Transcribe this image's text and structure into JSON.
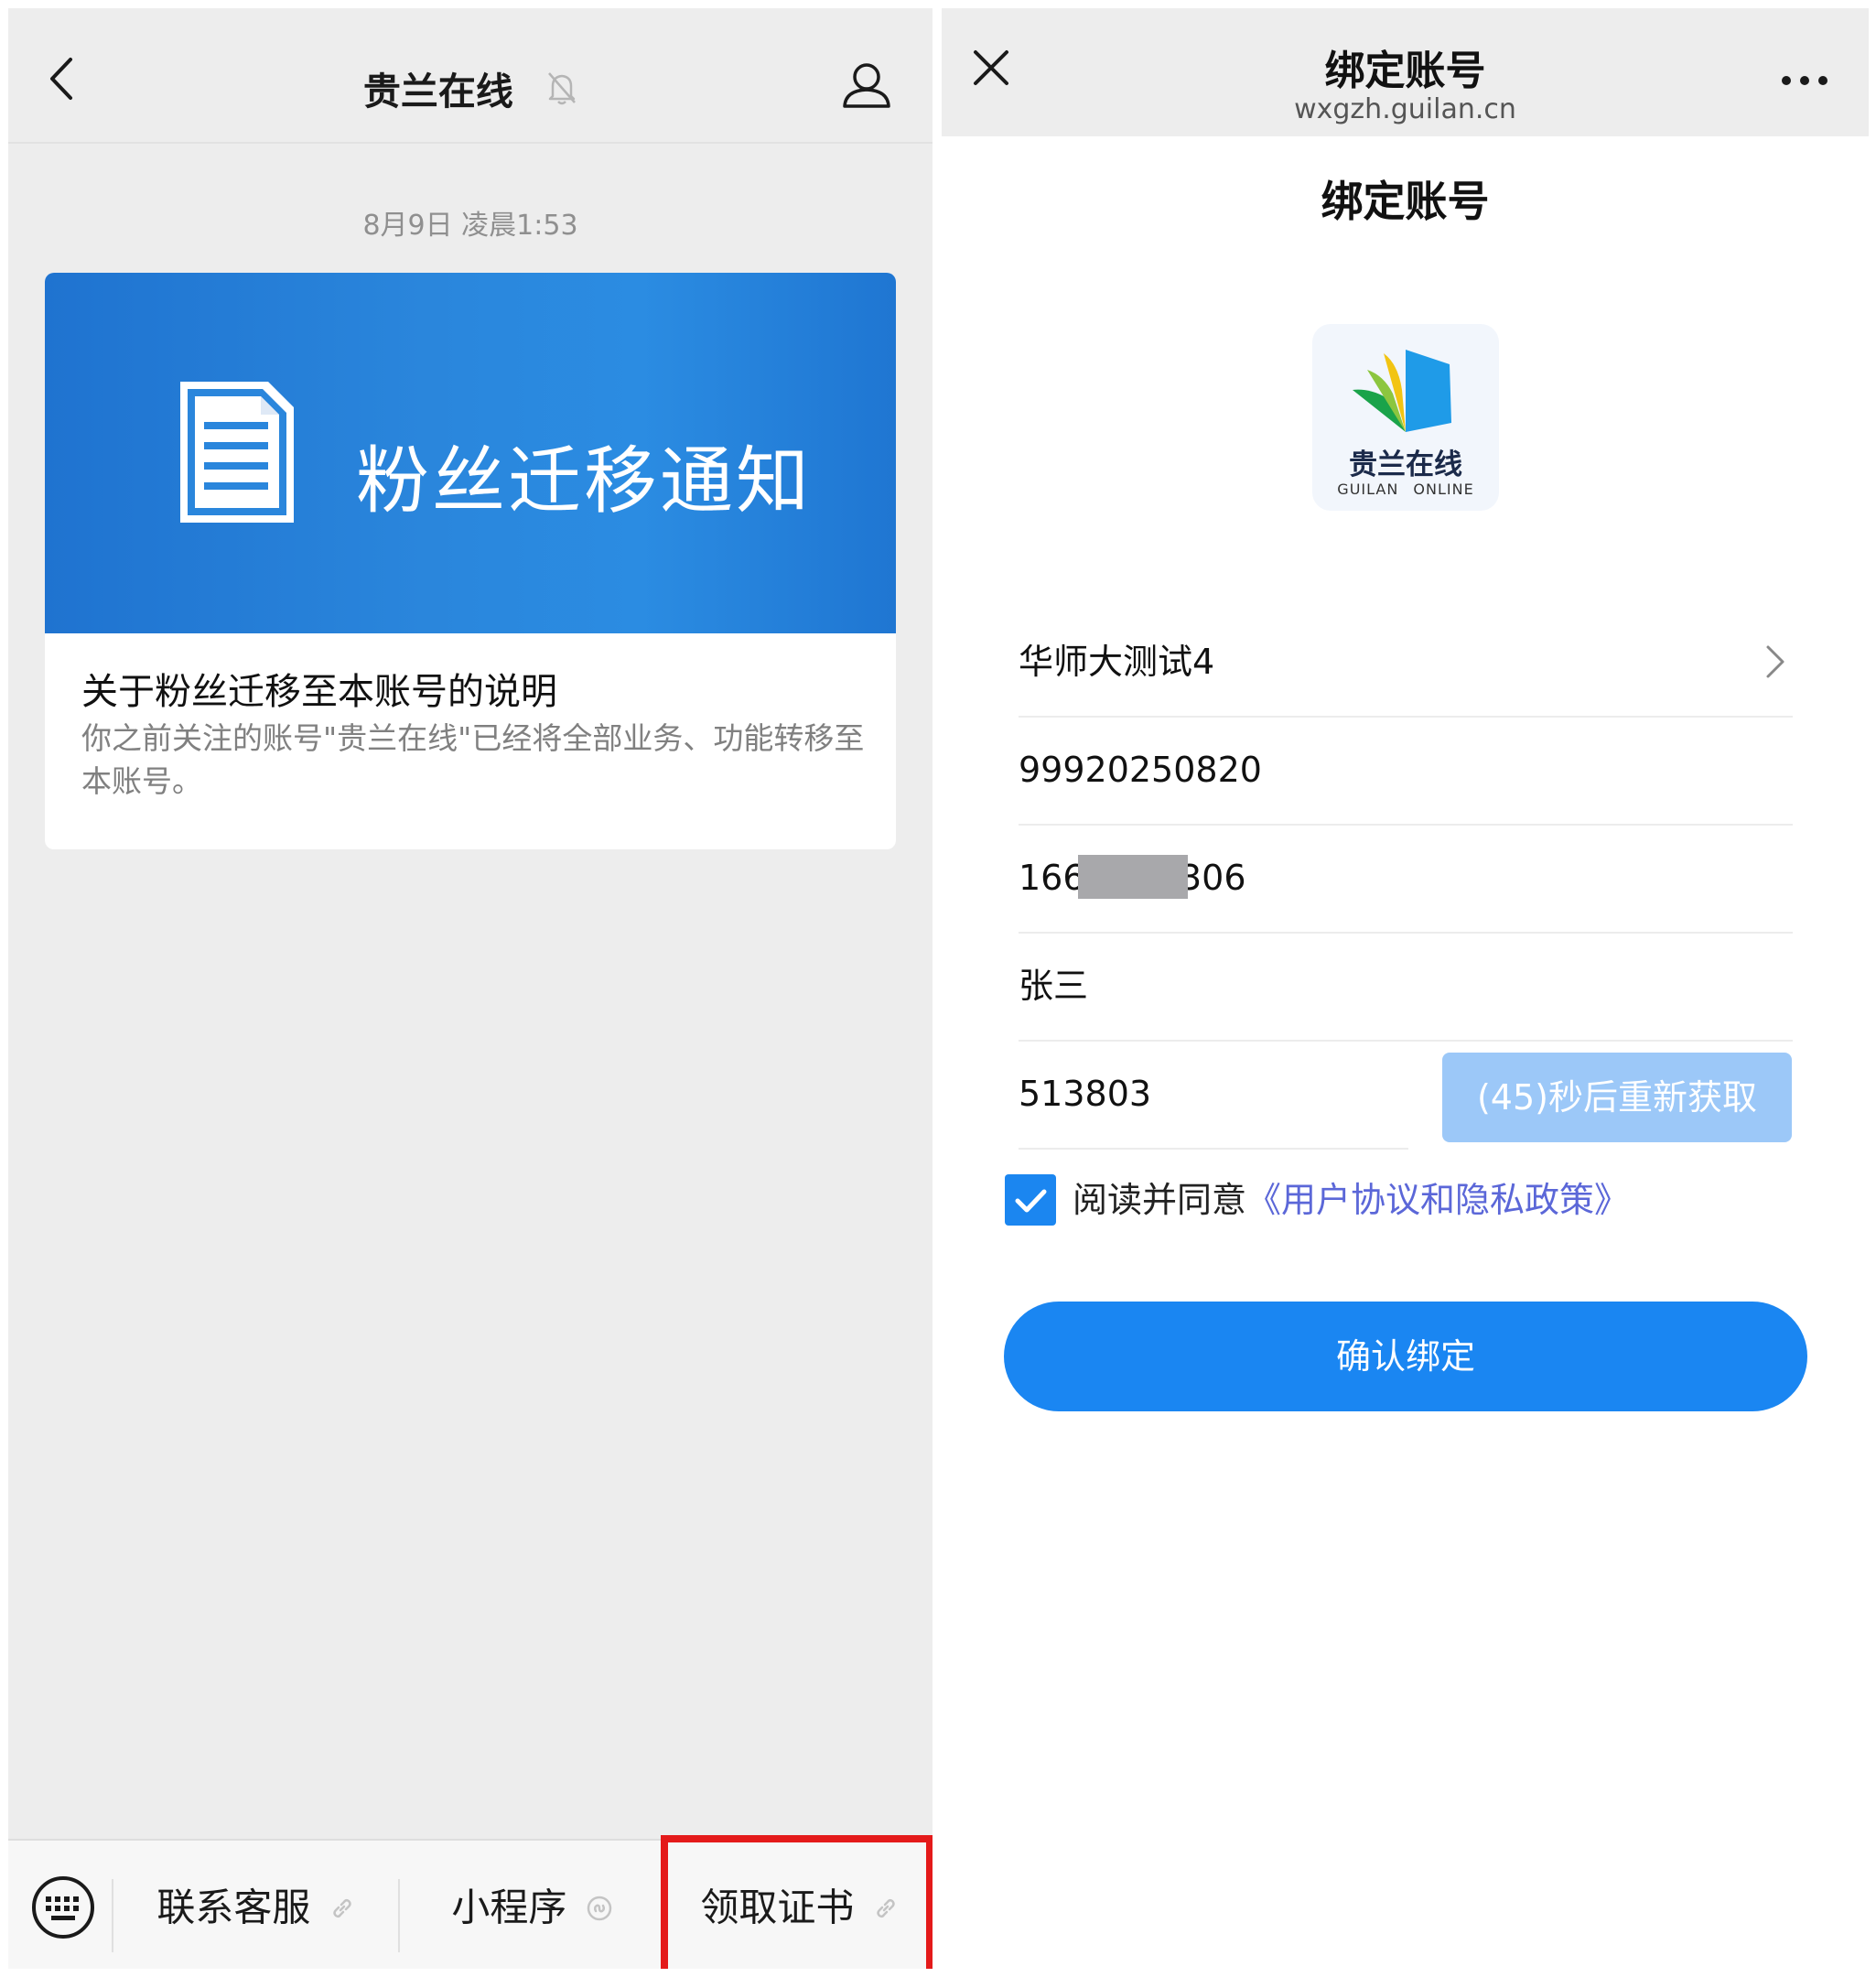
{
  "left_panel": {
    "header": {
      "title": "贵兰在线",
      "back_icon": "chevron-left-icon",
      "mute_icon": "bell-muted-icon",
      "profile_icon": "person-icon"
    },
    "timestamp": "8月9日 凌晨1:53",
    "article": {
      "cover_text": "粉丝迁移通知",
      "cover_icon": "document-icon",
      "cover_color": "#2a86dc",
      "title": "关于粉丝迁移至本账号的说明",
      "description": "你之前关注的账号\"贵兰在线\"已经将全部业务、功能转移至本账号。"
    },
    "menu": {
      "keyboard_icon": "keyboard-icon",
      "items": [
        {
          "label": "联系客服",
          "icon": "link-icon"
        },
        {
          "label": "小程序",
          "icon": "mini-program-icon"
        },
        {
          "label": "领取证书",
          "icon": "link-icon"
        }
      ],
      "highlight_color": "#e41a1a"
    }
  },
  "right_panel": {
    "header": {
      "title": "绑定账号",
      "url": "wxgzh.guilan.cn",
      "close_icon": "close-icon",
      "more_icon": "more-dots-icon"
    },
    "page_heading": "绑定账号",
    "logo": {
      "name_cn": "贵兰在线",
      "name_en": "GUILAN ONLINE"
    },
    "form": {
      "school": "华师大测试4",
      "student_id": "99920250820",
      "phone_prefix": "166",
      "phone_suffix": "306",
      "name": "张三",
      "code": "513803",
      "resend_label": "(45)秒后重新获取"
    },
    "agreement": {
      "checked": true,
      "text": "阅读并同意",
      "link": "《用户协议和隐私政策》"
    },
    "confirm_label": "确认绑定",
    "accent_color": "#1a86f2"
  }
}
